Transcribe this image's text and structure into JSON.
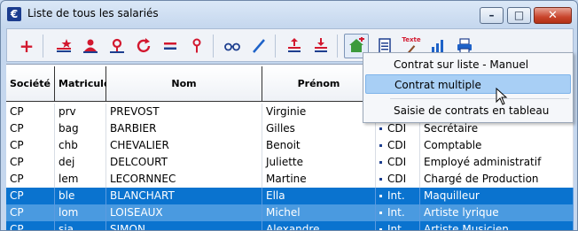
{
  "window": {
    "title": "Liste de tous les salariés",
    "app_icon": "€",
    "buttons": {
      "minimize": "–",
      "maximize": "□",
      "close": "✕"
    }
  },
  "toolbar": {
    "icons": [
      "add-icon",
      "add-star-icon",
      "add-person-icon",
      "search-person-icon",
      "refresh-icon",
      "equals-icon",
      "filter-icon",
      "glasses-icon",
      "pen-icon",
      "sort-up-icon",
      "sort-down-icon",
      "add-contract-icon",
      "document-icon",
      "text-edit-icon",
      "bar-chart-icon",
      "printer-icon"
    ],
    "text_icon_label": "Texte"
  },
  "colors": {
    "accent": "#d2182f",
    "selection": "#0a73cf",
    "selection_light": "#4a9ae0",
    "menu_hover": "#a8cff5"
  },
  "table": {
    "headers": {
      "societe": "Société",
      "matricule": "Matricule",
      "nom": "Nom",
      "prenom": "Prénom"
    },
    "rows": [
      {
        "societe": "CP",
        "matricule": "prv",
        "nom": "PREVOST",
        "prenom": "Virginie",
        "contrat": "",
        "poste": ""
      },
      {
        "societe": "CP",
        "matricule": "bag",
        "nom": "BARBIER",
        "prenom": "Gilles",
        "contrat": "CDI",
        "poste": "Secrétaire"
      },
      {
        "societe": "CP",
        "matricule": "chb",
        "nom": "CHEVALIER",
        "prenom": "Benoit",
        "contrat": "CDI",
        "poste": "Comptable"
      },
      {
        "societe": "CP",
        "matricule": "dej",
        "nom": "DELCOURT",
        "prenom": "Juliette",
        "contrat": "CDI",
        "poste": "Employé administratif"
      },
      {
        "societe": "CP",
        "matricule": "lem",
        "nom": "LECORNNEC",
        "prenom": "Martine",
        "contrat": "CDI",
        "poste": "Chargé de Production"
      },
      {
        "societe": "CP",
        "matricule": "ble",
        "nom": "BLANCHART",
        "prenom": "Ella",
        "contrat": "Int.",
        "poste": "Maquilleur"
      },
      {
        "societe": "CP",
        "matricule": "lom",
        "nom": "LOISEAUX",
        "prenom": "Michel",
        "contrat": "Int.",
        "poste": "Artiste lyrique"
      },
      {
        "societe": "CP",
        "matricule": "sia",
        "nom": "SIMON",
        "prenom": "Alexandre",
        "contrat": "Int.",
        "poste": "Artiste Musicien"
      }
    ]
  },
  "context_menu": {
    "items": [
      {
        "label": "Contrat sur liste - Manuel"
      },
      {
        "label": "Contrat multiple"
      },
      {
        "label": "Saisie de contrats en tableau"
      }
    ]
  }
}
